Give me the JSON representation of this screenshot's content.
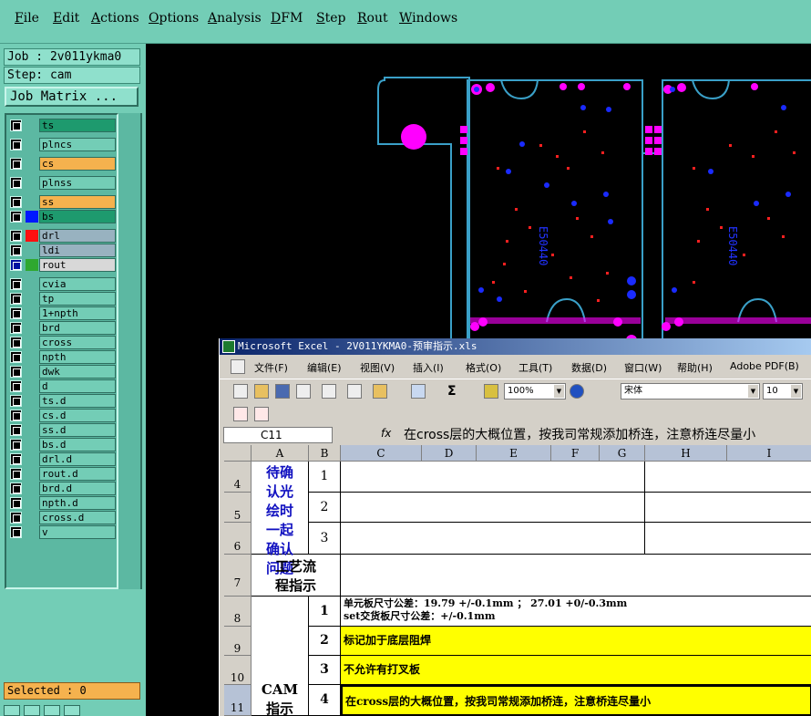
{
  "menubar": [
    "File",
    "Edit",
    "Actions",
    "Options",
    "Analysis",
    "DFM",
    "Step",
    "Rout",
    "Windows"
  ],
  "job": "Job : 2v011ykma0",
  "step": "Step: cam",
  "job_matrix": "Job Matrix ...",
  "layers": [
    {
      "name": "ts",
      "color": "#1e9a6e"
    },
    {
      "name": "plncs",
      "color": ""
    },
    {
      "name": "cs",
      "color": "#f5b24e"
    },
    {
      "name": "plnss",
      "color": ""
    },
    {
      "name": "ss",
      "color": "#f5b24e"
    },
    {
      "name": "bs",
      "color": "#1e9a6e",
      "swatch": "#0018ff"
    },
    {
      "name": "drl",
      "color": "#98b2c0",
      "swatch": "#ff1010"
    },
    {
      "name": "ldi",
      "color": "#98b2c0"
    },
    {
      "name": "rout",
      "color": "#d8d8d8",
      "swatch": "#2fa82f",
      "cbfill": "#0010a0"
    },
    {
      "name": "cvia"
    },
    {
      "name": "tp"
    },
    {
      "name": "1+npth"
    },
    {
      "name": "brd"
    },
    {
      "name": "cross"
    },
    {
      "name": "npth"
    },
    {
      "name": "dwk"
    },
    {
      "name": "d"
    },
    {
      "name": "ts.d"
    },
    {
      "name": "cs.d"
    },
    {
      "name": "ss.d"
    },
    {
      "name": "bs.d"
    },
    {
      "name": "drl.d"
    },
    {
      "name": "rout.d"
    },
    {
      "name": "brd.d"
    },
    {
      "name": "npth.d"
    },
    {
      "name": "cross.d"
    },
    {
      "name": "v"
    }
  ],
  "selected": "Selected : 0",
  "excel": {
    "title": "Microsoft Excel - 2V011YKMA0-预审指示.xls",
    "menus": [
      "文件(F)",
      "编辑(E)",
      "视图(V)",
      "插入(I)",
      "格式(O)",
      "工具(T)",
      "数据(D)",
      "窗口(W)",
      "帮助(H)",
      "Adobe PDF(B)"
    ],
    "zoom": "100%",
    "font": "宋体",
    "size": "10",
    "name_box": "C11",
    "fx": "fx",
    "formula": "在cross层的大概位置，按我司常规添加桥连，注意桥连尽量小",
    "columns": [
      "A",
      "B",
      "C",
      "D",
      "E",
      "F",
      "G",
      "H",
      "I"
    ],
    "rows": [
      "4",
      "5",
      "6",
      "7",
      "8",
      "9",
      "10",
      "11"
    ],
    "a_confirm": "待确认光绘时一起确认问题",
    "b_nums": [
      "1",
      "2",
      "3"
    ],
    "a_process": "工艺流程指示",
    "a_cam": "CAM指示",
    "cam_nums": [
      "1",
      "2",
      "3",
      "4"
    ],
    "cam_texts": [
      "单元板尺寸公差：19.79 +/-0.1mm ； 27.01 +0/-0.3mm",
      "set交货板尺寸公差：+/-0.1mm",
      "标记加于底层阻焊",
      "不允许有打叉板",
      "在cross层的大概位置，按我司常规添加桥连，注意桥连尽量小"
    ]
  }
}
